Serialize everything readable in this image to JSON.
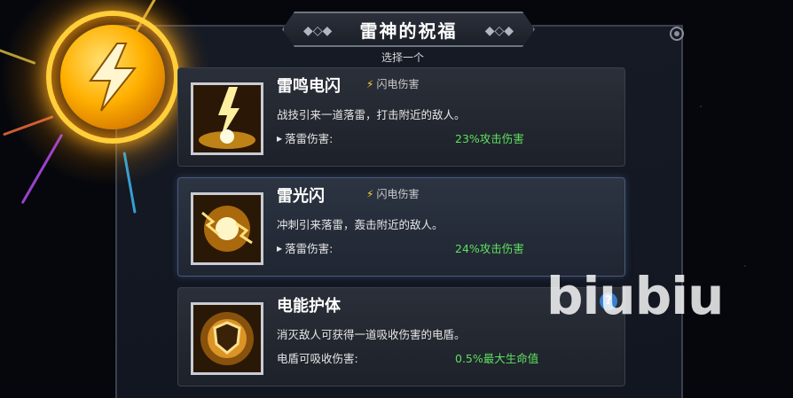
{
  "dialog": {
    "title": "雷神的祝福",
    "subtitle": "选择一个"
  },
  "blessings": [
    {
      "name": "雷鸣电闪",
      "tag": "闪电伤害",
      "description": "战技引来一道落雷，打击附近的敌人。",
      "stat_label": "落雷伤害:",
      "stat_value": "23%攻击伤害",
      "icon": "lightning-strike-icon"
    },
    {
      "name": "雷光闪",
      "tag": "闪电伤害",
      "description": "冲刺引来落雷，轰击附近的敌人。",
      "stat_label": "落雷伤害:",
      "stat_value": "24%攻击伤害",
      "icon": "lightning-orb-icon"
    },
    {
      "name": "电能护体",
      "tag": "",
      "description": "消灭敌人可获得一道吸收伤害的电盾。",
      "stat_label": "电盾可吸收伤害:",
      "stat_value": "0.5%最大生命值",
      "icon": "electric-shield-icon"
    }
  ],
  "selected_index": 1,
  "watermark": "biubiu",
  "help": "?",
  "colors": {
    "accent_gold": "#ffb000",
    "stat_green": "#5ee05e",
    "tag_bolt": "#ffd23a"
  }
}
